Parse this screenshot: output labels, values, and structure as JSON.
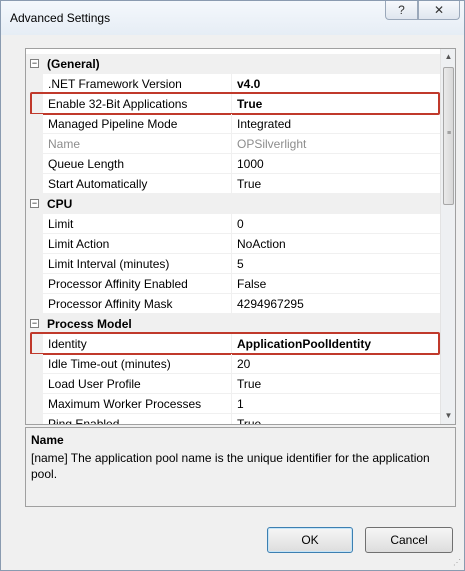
{
  "window": {
    "title": "Advanced Settings",
    "help_glyph": "?",
    "close_glyph": "✕"
  },
  "grid": {
    "toggle_glyph": "−",
    "rows": [
      {
        "kind": "category",
        "label": "(General)"
      },
      {
        "kind": "property",
        "name": ".NET Framework Version",
        "value": "v4.0",
        "value_style": "bold"
      },
      {
        "kind": "property",
        "name": "Enable 32-Bit Applications",
        "value": "True",
        "value_style": "bold",
        "highlighted": true
      },
      {
        "kind": "property",
        "name": "Managed Pipeline Mode",
        "value": "Integrated"
      },
      {
        "kind": "property",
        "name": "Name",
        "value": "OPSilverlight",
        "value_style": "grey",
        "name_style": "grey"
      },
      {
        "kind": "property",
        "name": "Queue Length",
        "value": "1000"
      },
      {
        "kind": "property",
        "name": "Start Automatically",
        "value": "True"
      },
      {
        "kind": "category",
        "label": "CPU"
      },
      {
        "kind": "property",
        "name": "Limit",
        "value": "0"
      },
      {
        "kind": "property",
        "name": "Limit Action",
        "value": "NoAction"
      },
      {
        "kind": "property",
        "name": "Limit Interval (minutes)",
        "value": "5"
      },
      {
        "kind": "property",
        "name": "Processor Affinity Enabled",
        "value": "False"
      },
      {
        "kind": "property",
        "name": "Processor Affinity Mask",
        "value": "4294967295"
      },
      {
        "kind": "category",
        "label": "Process Model"
      },
      {
        "kind": "property",
        "name": "Identity",
        "value": "ApplicationPoolIdentity",
        "value_style": "bold",
        "highlighted": true
      },
      {
        "kind": "property",
        "name": "Idle Time-out (minutes)",
        "value": "20"
      },
      {
        "kind": "property",
        "name": "Load User Profile",
        "value": "True"
      },
      {
        "kind": "property",
        "name": "Maximum Worker Processes",
        "value": "1"
      },
      {
        "kind": "property",
        "name": "Ping Enabled",
        "value": "True"
      }
    ],
    "scroll_up_glyph": "▲",
    "scroll_down_glyph": "▼"
  },
  "description": {
    "title": "Name",
    "text": "[name] The application pool name is the unique identifier for the application pool."
  },
  "buttons": {
    "ok_label": "OK",
    "cancel_label": "Cancel"
  },
  "colors": {
    "highlight_border": "#c0392b",
    "grid_line": "#f0f0f0"
  }
}
